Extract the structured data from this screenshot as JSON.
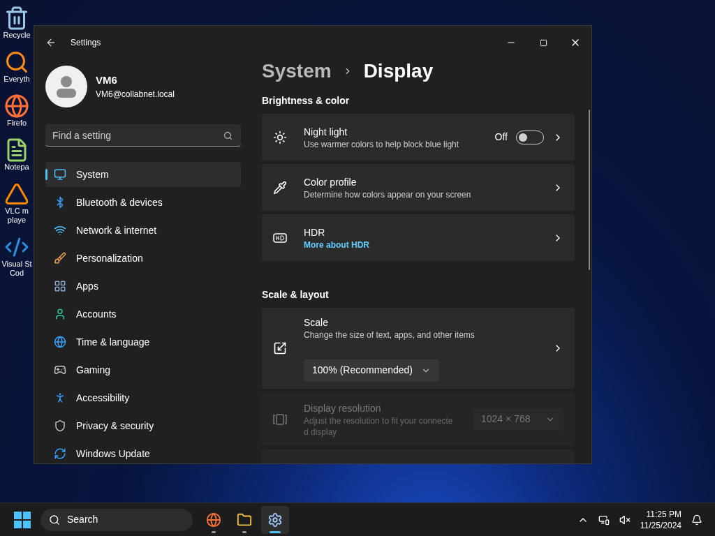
{
  "desktop_icons": [
    {
      "lines": [
        "Recycle"
      ]
    },
    {
      "lines": [
        "Everyth"
      ]
    },
    {
      "lines": [
        "Firefo"
      ]
    },
    {
      "lines": [
        "Notepa"
      ]
    },
    {
      "lines": [
        "VLC m",
        "playe"
      ]
    },
    {
      "lines": [
        "Visual St",
        "Cod"
      ]
    }
  ],
  "window": {
    "title": "Settings"
  },
  "account": {
    "name": "VM6",
    "email": "VM6@collabnet.local"
  },
  "search": {
    "placeholder": "Find a setting"
  },
  "nav": [
    {
      "label": "System",
      "selected": true
    },
    {
      "label": "Bluetooth & devices",
      "selected": false
    },
    {
      "label": "Network & internet",
      "selected": false
    },
    {
      "label": "Personalization",
      "selected": false
    },
    {
      "label": "Apps",
      "selected": false
    },
    {
      "label": "Accounts",
      "selected": false
    },
    {
      "label": "Time & language",
      "selected": false
    },
    {
      "label": "Gaming",
      "selected": false
    },
    {
      "label": "Accessibility",
      "selected": false
    },
    {
      "label": "Privacy & security",
      "selected": false
    },
    {
      "label": "Windows Update",
      "selected": false
    }
  ],
  "breadcrumb": [
    "System",
    "Display"
  ],
  "sections": [
    {
      "title": "Brightness & color",
      "rows": [
        {
          "kind": "toggle",
          "title": "Night light",
          "subtitle": "Use warmer colors to help block blue light",
          "state_label": "Off",
          "on": false
        },
        {
          "kind": "plain",
          "title": "Color profile",
          "subtitle": "Determine how colors appear on your screen"
        },
        {
          "kind": "link",
          "title": "HDR",
          "link": "More about HDR"
        }
      ]
    },
    {
      "title": "Scale & layout",
      "rows": [
        {
          "kind": "dropdown",
          "title": "Scale",
          "subtitle": "Change the size of text, apps, and other items",
          "value": "100% (Recommended)",
          "disabled": false
        },
        {
          "kind": "side-dropdown",
          "title": "Display resolution",
          "subtitle": "Adjust the resolution to fit your connected display",
          "value": "1024 × 768",
          "disabled": true
        },
        {
          "kind": "stub"
        }
      ]
    }
  ],
  "taskbar": {
    "search": "Search",
    "apps": [
      {
        "selected": false
      },
      {
        "selected": false
      },
      {
        "selected": true
      }
    ],
    "time": "11:25 PM",
    "date": "11/25/2024"
  }
}
